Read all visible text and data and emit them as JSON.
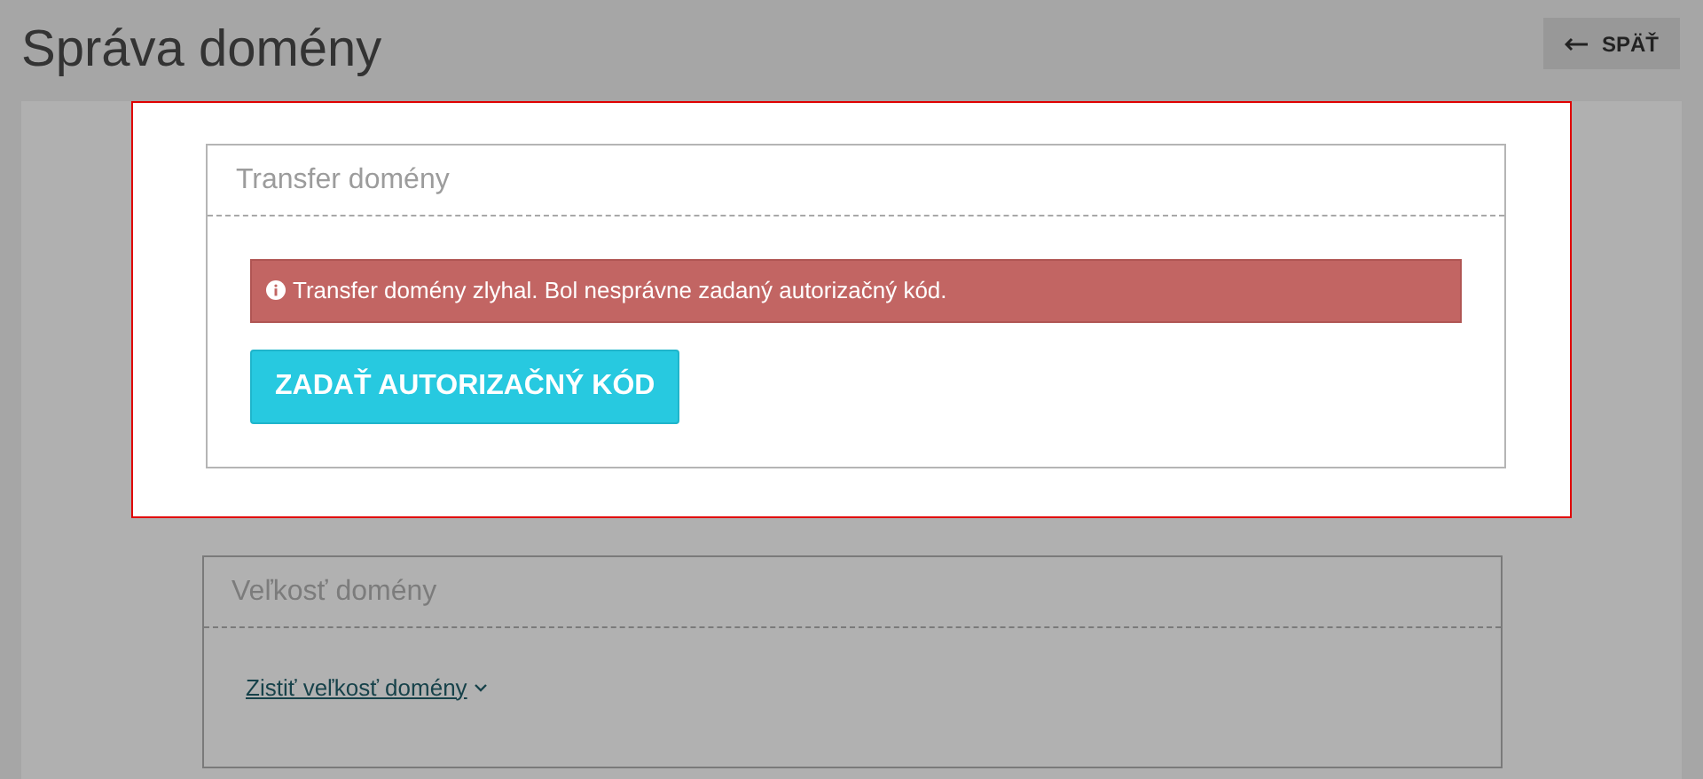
{
  "page_title": "Správa domény",
  "back_button": {
    "label": "SPÄŤ"
  },
  "transfer_panel": {
    "title": "Transfer domény",
    "highlighted": true,
    "alert": "Transfer domény zlyhal. Bol nesprávne zadaný autorizačný kód.",
    "button": "ZADAŤ AUTORIZAČNÝ KÓD"
  },
  "size_panel": {
    "title": "Veľkosť domény",
    "link": "Zistiť veľkosť domény",
    "expanded": false
  }
}
